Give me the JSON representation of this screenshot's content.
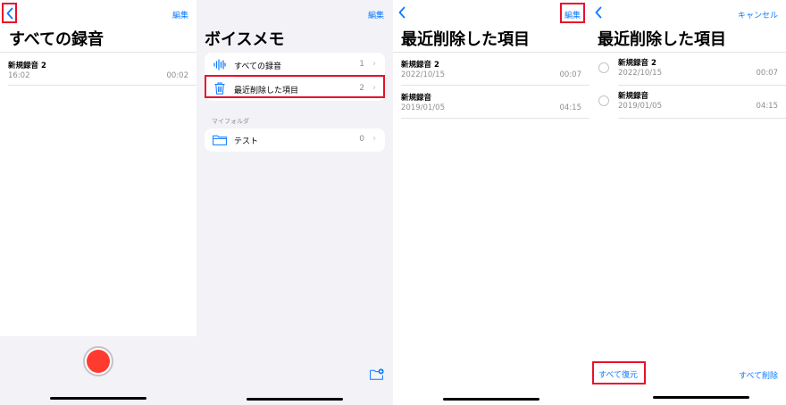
{
  "p1": {
    "edit_label": "編集",
    "title": "すべての録音",
    "recordings": [
      {
        "name": "新規録音 2",
        "time": "16:02",
        "duration": "00:02"
      }
    ]
  },
  "p2": {
    "edit_label": "編集",
    "title": "ボイスメモ",
    "items": [
      {
        "label": "すべての録音",
        "count": "1"
      },
      {
        "label": "最近削除した項目",
        "count": "2"
      }
    ],
    "section_header": "マイフォルダ",
    "folders": [
      {
        "label": "テスト",
        "count": "0"
      }
    ]
  },
  "p3": {
    "edit_label": "編集",
    "title": "最近削除した項目",
    "recordings": [
      {
        "name": "新規録音 2",
        "date": "2022/10/15",
        "duration": "00:07"
      },
      {
        "name": "新規録音",
        "date": "2019/01/05",
        "duration": "04:15"
      }
    ]
  },
  "p4": {
    "cancel_label": "キャンセル",
    "title": "最近削除した項目",
    "recordings": [
      {
        "name": "新規録音 2",
        "date": "2022/10/15",
        "duration": "00:07"
      },
      {
        "name": "新規録音",
        "date": "2019/01/05",
        "duration": "04:15"
      }
    ],
    "recover_all_label": "すべて復元",
    "delete_all_label": "すべて削除"
  },
  "colors": {
    "accent": "#0a7aff",
    "record": "#ff3b30",
    "highlight": "#e8112d"
  }
}
